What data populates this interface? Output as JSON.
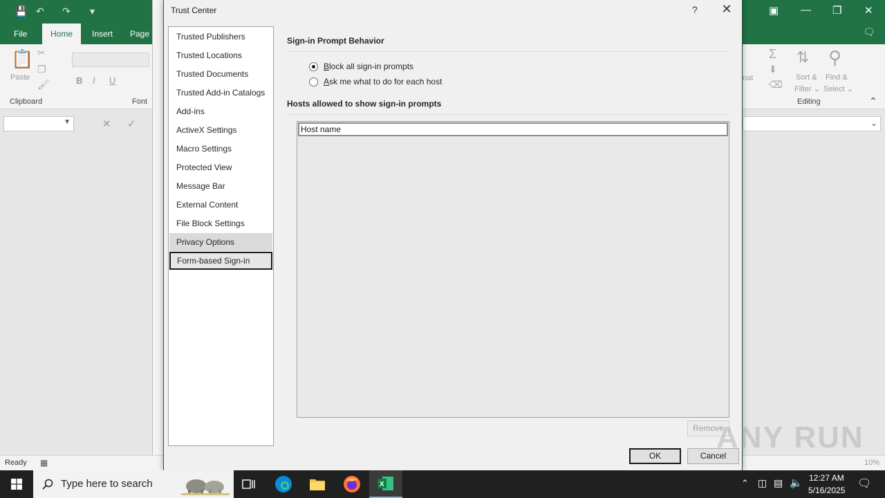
{
  "excel": {
    "tabs": [
      "File",
      "Home",
      "Insert",
      "Page L"
    ],
    "ribbon": {
      "clipboard_label": "Clipboard",
      "paste_label": "Paste",
      "font_label": "Font",
      "editing_label": "Editing",
      "sort_filter_1": "Sort &",
      "sort_filter_2": "Filter ⌄",
      "find_select_1": "Find &",
      "find_select_2": "Select ⌄",
      "format_partial": "nat"
    },
    "status": "Ready",
    "zoom": "10%"
  },
  "dialog": {
    "title": "Trust Center",
    "help": "?",
    "nav": [
      "Trusted Publishers",
      "Trusted Locations",
      "Trusted Documents",
      "Trusted Add-in Catalogs",
      "Add-ins",
      "ActiveX Settings",
      "Macro Settings",
      "Protected View",
      "Message Bar",
      "External Content",
      "File Block Settings",
      "Privacy Options",
      "Form-based Sign-in"
    ],
    "selected_nav": "Form-based Sign-in",
    "hover_nav": "Privacy Options",
    "section1_title": "Sign-in Prompt Behavior",
    "option1_hot": "B",
    "option1_rest": "lock all sign-in prompts",
    "option2_hot": "A",
    "option2_rest": "sk me what to do for each host",
    "selected_option": "Block all sign-in prompts",
    "section2_title": "Hosts allowed to show sign-in prompts",
    "host_input_value": "Host name",
    "remove_label": "Remove",
    "ok_label": "OK",
    "cancel_label": "Cancel"
  },
  "taskbar": {
    "search_placeholder": "Type here to search",
    "time": "12:27 AM",
    "date": "5/16/2025"
  },
  "watermark": "ANY RUN",
  "colors": {
    "excel_green": "#217346",
    "taskbar": "#202020",
    "dialog_bg": "#f0f0f0"
  }
}
